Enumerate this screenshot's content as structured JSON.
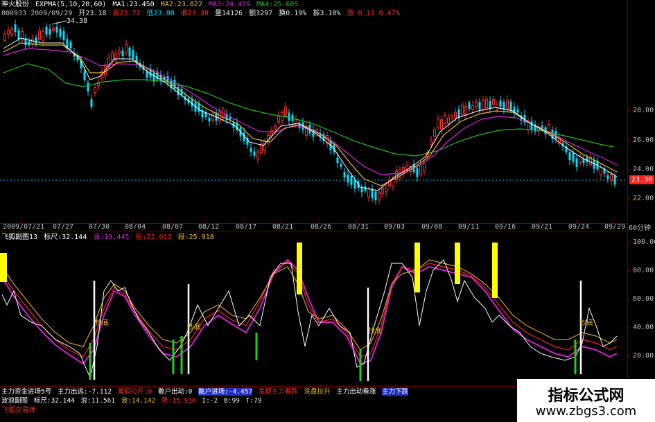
{
  "colors": {
    "up": "#ff3030",
    "down": "#00e0ff",
    "ma1": "#ffffff",
    "ma2": "#e8c030",
    "ma3": "#e020e0",
    "ma4": "#20c020",
    "white": "#ffffff",
    "yellow": "#ffff00",
    "green": "#20d020",
    "axis_red": "#a00000",
    "sub_white": "#ffffff",
    "sub_yellow": "#d0a030",
    "sub_red": "#ff2020",
    "sub_magenta": "#d020d0"
  },
  "header": {
    "stock_name": "神火股份",
    "indicator": "EXPMA(5,10,20,60)",
    "ma1": "MA1:23.450",
    "ma2": "MA2:23.822",
    "ma3": "MA3:24.479",
    "ma4": "MA4:25.605",
    "code_date": "000933 2009/09/29",
    "open": "开23.18",
    "high": "高23.72",
    "low": "低23.00",
    "close": "收23.30",
    "volume": "量14126",
    "amount": "额3297",
    "turnover": "换0.19%",
    "amplitude": "振3.10%",
    "change": "涨 0.11 0.47%"
  },
  "main_chart": {
    "peak_label": "34.38",
    "price_ticks": [
      "28.00",
      "26.00",
      "24.00",
      "22.00"
    ],
    "current_price": "23.30",
    "period": "60分钟",
    "dates": [
      "2009/07/21",
      "07/27",
      "07/30",
      "08/04",
      "08/07",
      "08/12",
      "08/17",
      "08/21",
      "08/26",
      "08/31",
      "09/03",
      "09/08",
      "09/11",
      "09/16",
      "09/21",
      "09/24",
      "09/29"
    ]
  },
  "sub_chart": {
    "title": "飞狐副图13",
    "ruler": "标尺:32.144",
    "wave": "浪:19.445",
    "shape": "形:22.013",
    "segment": "段:25.918",
    "ticks": [
      "100.00",
      "80.00",
      "60.00",
      "40.00",
      "20.00"
    ],
    "labels": [
      "抄底",
      "抄底",
      "抄底",
      "抄底"
    ]
  },
  "bottom": {
    "row1": [
      "主力资金进场5号",
      "主力出逃:-7.112",
      "筹码拉升:0",
      "散户出动:0",
      "散户进场:-4.457",
      "发现主力看跌",
      "洗盘拉升",
      "主力出动看涨",
      "主力下跌"
    ],
    "row2": [
      "波浪副图",
      "标尺:32.144",
      "浪:11.561",
      "波:14.142",
      "势:15.930",
      "I:-2",
      "B:99",
      "T:79"
    ],
    "row3": "飞狐交易师"
  },
  "watermark": {
    "title": "指标公式网",
    "url": "www.zbgs3.com"
  }
}
